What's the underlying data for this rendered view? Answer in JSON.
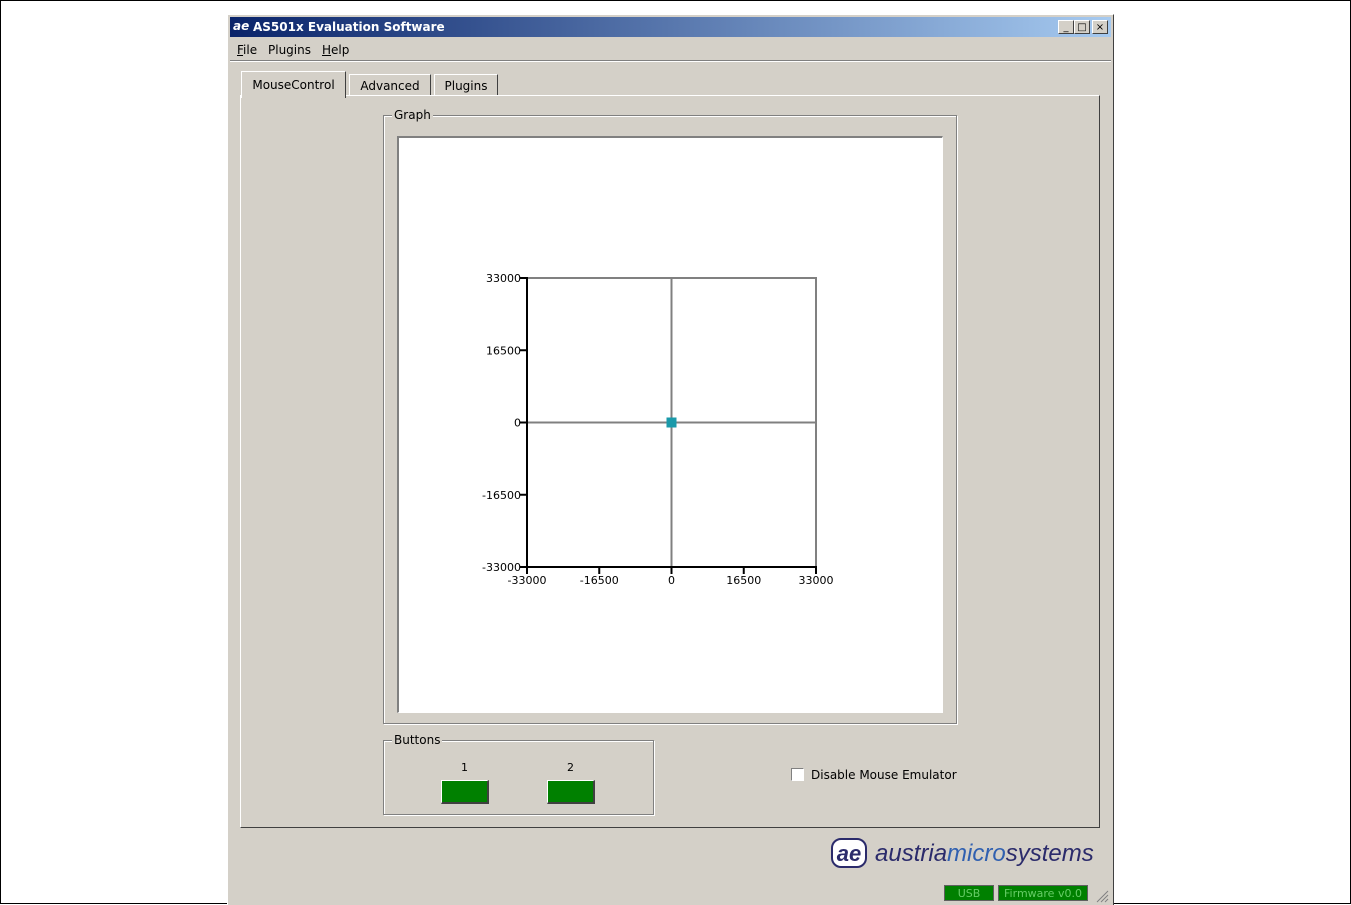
{
  "window": {
    "title": "AS501x Evaluation Software",
    "icon": "ae-logo-icon",
    "controls": {
      "minimize": "_",
      "maximize": "□",
      "close": "×"
    }
  },
  "menu": {
    "items": [
      {
        "mnemonic": "F",
        "rest": "ile"
      },
      {
        "mnemonic": "",
        "rest": "Plugins"
      },
      {
        "mnemonic": "H",
        "rest": "elp"
      }
    ]
  },
  "tabs": [
    {
      "label": "MouseControl",
      "active": true
    },
    {
      "label": "Advanced",
      "active": false
    },
    {
      "label": "Plugins",
      "active": false
    }
  ],
  "graph_group": {
    "label": "Graph"
  },
  "chart_data": {
    "type": "scatter",
    "xlim": [
      -33000,
      33000
    ],
    "ylim": [
      -33000,
      33000
    ],
    "x_ticks": [
      "-33000",
      "-16500",
      "0",
      "16500",
      "33000"
    ],
    "y_ticks": [
      "33000",
      "16500",
      "0",
      "-16500",
      "-33000"
    ],
    "points": [
      {
        "x": 0,
        "y": 0
      }
    ],
    "point_color": "#1a9aaa",
    "grid": "center crosshair"
  },
  "buttons_group": {
    "label": "Buttons",
    "button1_label": "1",
    "button2_label": "2",
    "state_color": "#008000"
  },
  "disable_emulator": {
    "label": "Disable Mouse Emulator",
    "checked": false
  },
  "logo": {
    "prefix": "austria",
    "mid": "micro",
    "suffix": "systems",
    "mark": "ae"
  },
  "status": {
    "usb": "USB",
    "firmware": "Firmware v0.0"
  }
}
